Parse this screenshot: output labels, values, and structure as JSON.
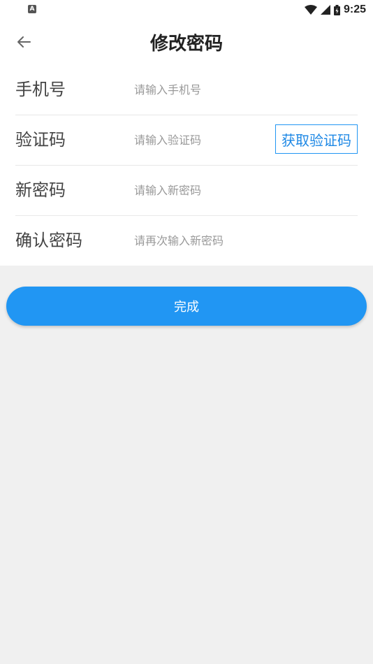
{
  "status_bar": {
    "app_icon_glyph": "A",
    "time": "9:25",
    "icons": [
      "wifi-icon",
      "cellular-signal-icon",
      "battery-icon"
    ]
  },
  "header": {
    "title": "修改密码",
    "back_icon": "arrow-left-icon"
  },
  "form": {
    "rows": [
      {
        "label": "手机号",
        "placeholder": "请输入手机号"
      },
      {
        "label": "验证码",
        "placeholder": "请输入验证码",
        "action_label": "获取验证码"
      },
      {
        "label": "新密码",
        "placeholder": "请输入新密码"
      },
      {
        "label": "确认密码",
        "placeholder": "请再次输入新密码"
      }
    ]
  },
  "submit": {
    "label": "完成"
  },
  "colors": {
    "accent": "#2196f3",
    "background": "#f0f0f0",
    "card": "#ffffff"
  }
}
